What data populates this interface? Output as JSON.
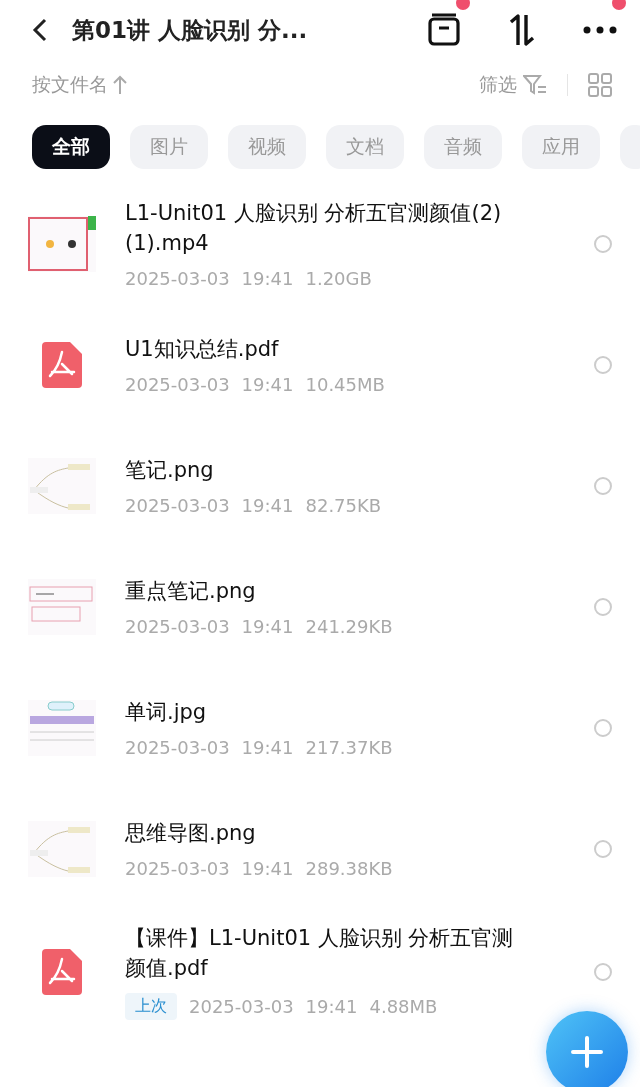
{
  "header": {
    "title": "第01讲 人脸识别 分...",
    "actions": [
      {
        "kind": "box",
        "dot": true
      },
      {
        "kind": "sort",
        "dot": false
      },
      {
        "kind": "more",
        "dot": true
      }
    ]
  },
  "toolbar": {
    "sort_label": "按文件名",
    "filter_label": "筛选"
  },
  "chips": [
    {
      "label": "全部",
      "selected": true
    },
    {
      "label": "图片",
      "selected": false
    },
    {
      "label": "视频",
      "selected": false
    },
    {
      "label": "文档",
      "selected": false
    },
    {
      "label": "音频",
      "selected": false
    },
    {
      "label": "应用",
      "selected": false
    }
  ],
  "files": [
    {
      "kind": "video",
      "name": "L1-Unit01 人脸识别 分析五官测颜值(2)  (1).mp4",
      "date": "2025-03-03",
      "time": "19:41",
      "size": "1.20GB",
      "selected": false
    },
    {
      "kind": "pdf",
      "name": "U1知识总结.pdf",
      "date": "2025-03-03",
      "time": "19:41",
      "size": "10.45MB",
      "selected": false
    },
    {
      "name": "笔记.png",
      "date": "2025-03-03",
      "time": "19:41",
      "size": "82.75KB",
      "selected": false
    },
    {
      "name": "重点笔记.png",
      "date": "2025-03-03",
      "time": "19:41",
      "size": "241.29KB",
      "selected": false
    },
    {
      "name": "单词.jpg",
      "date": "2025-03-03",
      "time": "19:41",
      "size": "217.37KB",
      "selected": false
    },
    {
      "name": "思维导图.png",
      "date": "2025-03-03",
      "time": "19:41",
      "size": "289.38KB",
      "selected": false
    },
    {
      "kind": "pdf",
      "name": "【课件】L1-Unit01 人脸识别 分析五官测颜值.pdf",
      "badge": "上次",
      "date": "2025-03-03",
      "time": "19:41",
      "size": "4.88MB",
      "selected": false
    }
  ]
}
